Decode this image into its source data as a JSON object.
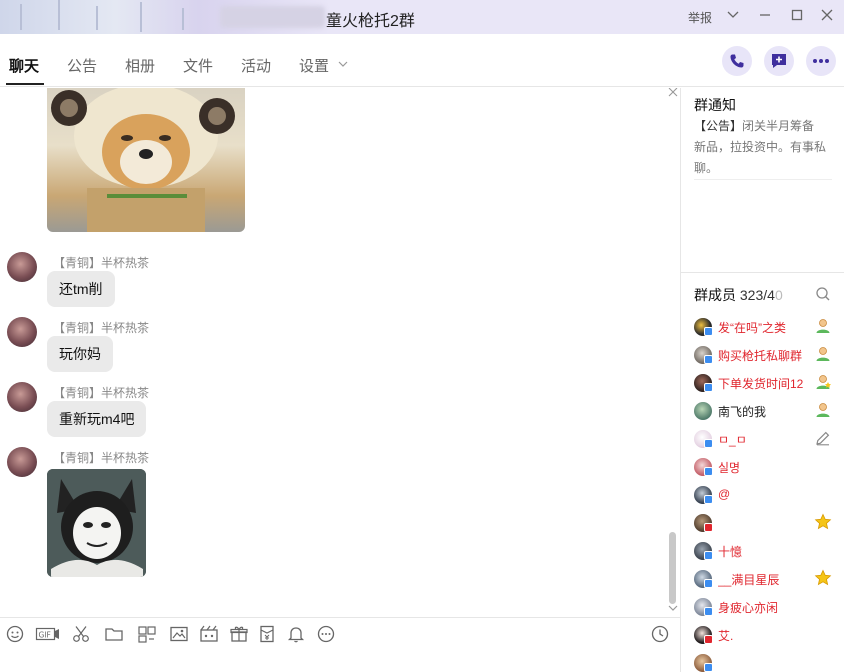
{
  "window": {
    "title": "童火枪托2群",
    "report_label": "举报",
    "controls": [
      "chevron-down-icon",
      "minimize-icon",
      "maximize-icon",
      "close-icon"
    ]
  },
  "tabs": [
    {
      "label": "聊天",
      "active": true
    },
    {
      "label": "公告",
      "active": false
    },
    {
      "label": "相册",
      "active": false
    },
    {
      "label": "文件",
      "active": false
    },
    {
      "label": "活动",
      "active": false
    },
    {
      "label": "设置",
      "active": false
    }
  ],
  "header_actions": [
    "phone-icon",
    "add-chat-icon",
    "more-icon"
  ],
  "messages": [
    {
      "sender": "【青铜】半杯热茶",
      "text": "还tm削"
    },
    {
      "sender": "【青铜】半杯热茶",
      "text": "玩你妈"
    },
    {
      "sender": "【青铜】半杯热茶",
      "text": "重新玩m4吧"
    },
    {
      "sender": "【青铜】半杯热茶",
      "text": "",
      "sticker": "husky-meme-sticker"
    }
  ],
  "toolbar": [
    "emoji-icon",
    "gif-icon",
    "scissors-icon",
    "folder-icon",
    "screenshot-icon",
    "image-icon",
    "video-icon",
    "gift-icon",
    "red-packet-icon",
    "bell-icon",
    "more-circle-icon"
  ],
  "toolbar_right": "history-clock-icon",
  "notice": {
    "title": "群通知",
    "tag": "【公告】",
    "body": "闭关半月筹备新品，拉投资中。有事私聊。"
  },
  "members": {
    "title": "群成员",
    "count": "323/4",
    "count_fade": "0",
    "list": [
      {
        "name": "发“在吗”之类",
        "color": "red",
        "icon": "admin-person-icon"
      },
      {
        "name": "购买枪托私聊群",
        "color": "red",
        "icon": "admin-person-icon"
      },
      {
        "name": "下单发货时间12",
        "color": "red",
        "icon": "admin-person-star-icon"
      },
      {
        "name": "南飞的我",
        "color": "black",
        "icon": "admin-person-icon"
      },
      {
        "name": "ㅁ_ㅁ",
        "color": "red",
        "icon": "edit-icon"
      },
      {
        "name": "실명",
        "color": "red",
        "icon": ""
      },
      {
        "name": "@",
        "color": "red",
        "icon": ""
      },
      {
        "name": "",
        "color": "red",
        "icon": "star-icon"
      },
      {
        "name": "十憶",
        "color": "red",
        "icon": ""
      },
      {
        "name": "__满目星辰",
        "color": "red",
        "icon": "star-icon"
      },
      {
        "name": "身疲心亦闲",
        "color": "red",
        "icon": ""
      },
      {
        "name": "艾.",
        "color": "red",
        "icon": ""
      },
      {
        "name": "",
        "color": "red",
        "icon": ""
      }
    ]
  },
  "colors": {
    "title_bar": "#e9e6f7",
    "accent": "#4a3aa8",
    "member_red": "#e0262e",
    "bubble": "#eaeaea"
  }
}
